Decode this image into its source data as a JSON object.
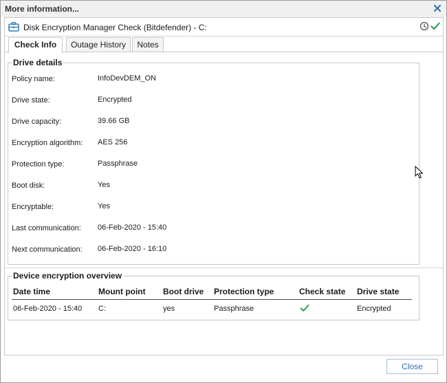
{
  "window": {
    "title": "More information...",
    "close_icon": "close-icon",
    "close_label": "Close"
  },
  "check": {
    "title": "Disk Encryption Manager Check (Bitdefender) - C:",
    "icon": "briefcase-icon",
    "status_icon": "checkmark-icon",
    "history_icon": "history-icon",
    "accent": "#2a7ab8",
    "ok_color": "#2e9e4f"
  },
  "tabs": [
    {
      "label": "Check Info",
      "active": true
    },
    {
      "label": "Outage History",
      "active": false
    },
    {
      "label": "Notes",
      "active": false
    }
  ],
  "drive_details": {
    "title": "Drive details",
    "fields": [
      {
        "label": "Policy name:",
        "value": "InfoDevDEM_ON"
      },
      {
        "label": "Drive state:",
        "value": "Encrypted"
      },
      {
        "label": "Drive capacity:",
        "value": "39.66 GB"
      },
      {
        "label": "Encryption algorithm:",
        "value": "AES 256"
      },
      {
        "label": "Protection type:",
        "value": "Passphrase"
      },
      {
        "label": "Boot disk:",
        "value": "Yes"
      },
      {
        "label": "Encryptable:",
        "value": "Yes"
      },
      {
        "label": "Last communication:",
        "value": "06-Feb-2020 - 15:40"
      },
      {
        "label": "Next communication:",
        "value": "06-Feb-2020 - 16:10"
      }
    ]
  },
  "overview": {
    "title": "Device encryption overview",
    "columns": [
      "Date time",
      "Mount point",
      "Boot drive",
      "Protection type",
      "Check state",
      "Drive state"
    ],
    "rows": [
      {
        "date_time": "06-Feb-2020 - 15:40",
        "mount_point": "C:",
        "boot_drive": "yes",
        "protection_type": "Passphrase",
        "check_state_icon": "checkmark-icon",
        "drive_state": "Encrypted"
      }
    ]
  }
}
